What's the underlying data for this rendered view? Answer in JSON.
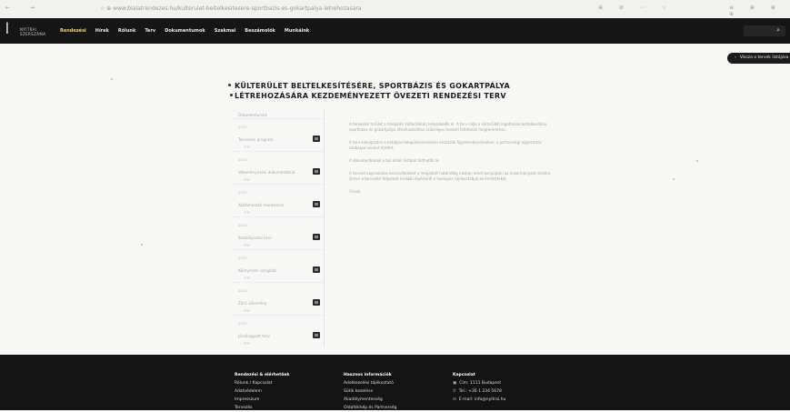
{
  "browser": {
    "nav_icons": "← →",
    "url": "☆ ⊕ www.bialatrendezes.hu/kulterulet-beltelkesitesere-sportbazis-es-gokartpalya-letrehozasara",
    "right_icons": "⊕ ⊘ ⋯ ☆",
    "far_right_icons": "≡ ⊕ ⊕ ⊕"
  },
  "header": {
    "logo_text_line1": "NYITRAI",
    "logo_text_line2": "SZERSZÁMA",
    "nav_items": [
      "Rendezési",
      "Hírek",
      "Rólunk",
      "Terv",
      "Dokumentumok",
      "Szakmai",
      "Beszámolók",
      "Munkáink"
    ],
    "search_icon": "⌕"
  },
  "pill_button": {
    "arrow": "‹",
    "label": "Vissza a tervek listájára"
  },
  "page": {
    "title": "KÜLTERÜLET BELTELKESÍTÉSÉRE, SPORTBÁZIS ÉS GOKARTPÁLYA LÉTREHOZÁSÁRA KEZDEMÉNYEZETT ÖVEZETI RENDEZÉSI TERV"
  },
  "documents": {
    "header": "Dokumentumok",
    "items": [
      {
        "meta": "2021.",
        "label": "Tervezési program",
        "sub": "PDF"
      },
      {
        "meta": "2021.",
        "label": "Véleményezési dokumentáció",
        "sub": "PDF"
      },
      {
        "meta": "2021.",
        "label": "Alátámasztó munkarész",
        "sub": "PDF"
      },
      {
        "meta": "2022.",
        "label": "Szabályozási terv",
        "sub": "PDF"
      },
      {
        "meta": "2022.",
        "label": "Környezeti vizsgálat",
        "sub": "PDF"
      },
      {
        "meta": "2022.",
        "label": "Záró vélemény",
        "sub": "PDF"
      },
      {
        "meta": "2022.",
        "label": "Jóváhagyott terv",
        "sub": "PDF"
      }
    ]
  },
  "description": {
    "p1": "A tervezési terület a település külterületén helyezkedik el. A terv célja a külterületi ingatlanok beltelkesítése, sportbázis és gokartpálya létrehozásához szükséges övezeti feltételek megteremtése.",
    "p2": "A terv kidolgozása a hatályos településrendezési eszközök figyelembevételével, a partnerségi egyeztetés szabályai szerint történt.",
    "p3": "A dokumentumok a bal oldali listából tölthetők le.",
    "p4": "A tervvel kapcsolatos észrevételeket a megadott határidőig írásban lehet benyújtani az önkormányzat részére, illetve a tervezési folyamat további lépéseiről a honlapon tájékoztatjuk az érintetteket.",
    "link": "Vissza"
  },
  "footer": {
    "col1": [
      "Rendezési & elérhetőek",
      "Rólunk / Kapcsolat",
      "Adatvédelem",
      "Impresszum",
      "Tervezés"
    ],
    "col2": [
      "Hasznos információk",
      "Adatkezelési tájékoztató",
      "Sütik kezelése",
      "Akadálymentesség",
      "Oldaltérkép és Partnerség"
    ],
    "col3_title": "Kapcsolat",
    "col3": [
      {
        "icon": "▣",
        "text": "Cím: 1111 Budapest"
      },
      {
        "icon": "✆",
        "text": "Tel.: +36 1 234 5678"
      },
      {
        "icon": "✉",
        "text": "E-mail: info@nyitrai.hu"
      }
    ]
  }
}
